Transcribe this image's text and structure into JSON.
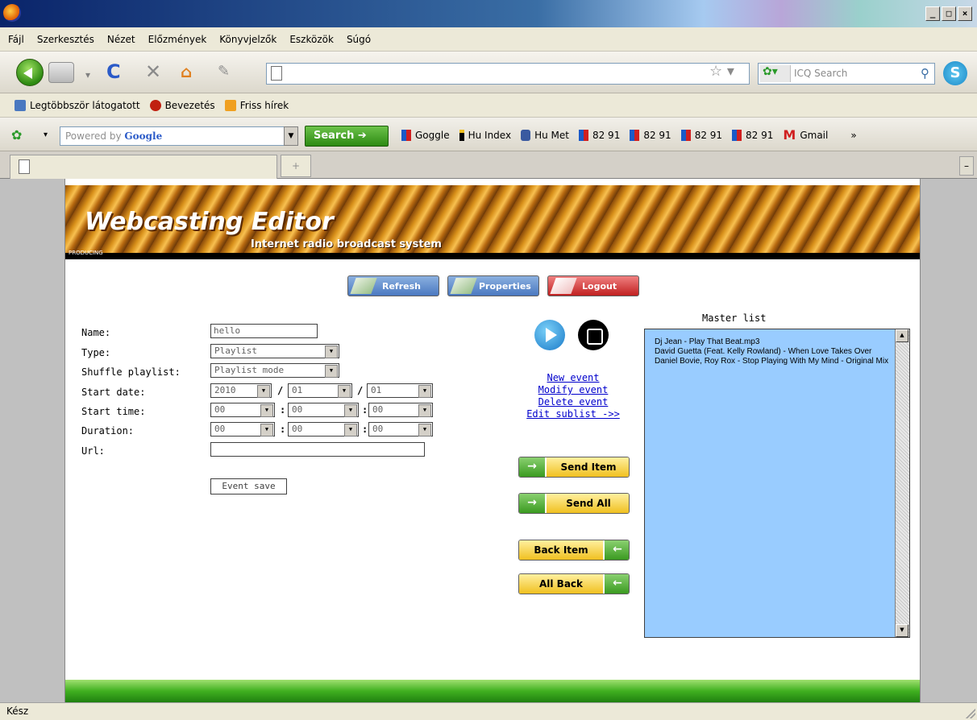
{
  "menu": [
    "Fájl",
    "Szerkesztés",
    "Nézet",
    "Előzmények",
    "Könyvjelzők",
    "Eszközök",
    "Súgó"
  ],
  "nav": {
    "icq_placeholder": "ICQ Search"
  },
  "bookmarks": [
    "Legtöbbször látogatott",
    "Bevezetés",
    "Friss hírek"
  ],
  "toolbar": {
    "powered_by": "Powered by",
    "google": "Google",
    "search_label": "Search",
    "links": [
      "Goggle",
      "Hu Index",
      "Hu Met",
      "82 91",
      "82 91",
      "82 91",
      "82 91",
      "Gmail"
    ],
    "overflow": "»"
  },
  "banner": {
    "title": "Webcasting Editor",
    "subtitle": "Internet radio broadcast system",
    "tag": "PRODUCING"
  },
  "buttons": {
    "refresh": "Refresh",
    "properties": "Properties",
    "logout": "Logout"
  },
  "form": {
    "labels": {
      "name": "Name:",
      "type": "Type:",
      "shuffle": "Shuffle playlist:",
      "start_date": "Start date:",
      "start_time": "Start time:",
      "duration": "Duration:",
      "url": "Url:"
    },
    "name_value": "hello",
    "type_value": "Playlist",
    "shuffle_value": "Playlist mode",
    "date": [
      "2010",
      "01",
      "01"
    ],
    "time": [
      "00",
      "00",
      "00"
    ],
    "duration": [
      "00",
      "00",
      "00"
    ],
    "url_value": "",
    "event_save": "Event save"
  },
  "event_links": [
    "New event",
    "Modify event",
    "Delete event",
    "Edit sublist ->>"
  ],
  "move_buttons": {
    "send_item": "Send Item",
    "send_all": "Send All",
    "back_item": "Back Item",
    "all_back": "All Back"
  },
  "master_list": {
    "label": "Master list",
    "items": [
      "Dj Jean - Play That Beat.mp3",
      "David Guetta (Feat. Kelly Rowland) - When Love Takes Over",
      "Daniel Bovie, Roy Rox - Stop Playing With My Mind - Original Mix"
    ]
  },
  "status": "Kész"
}
